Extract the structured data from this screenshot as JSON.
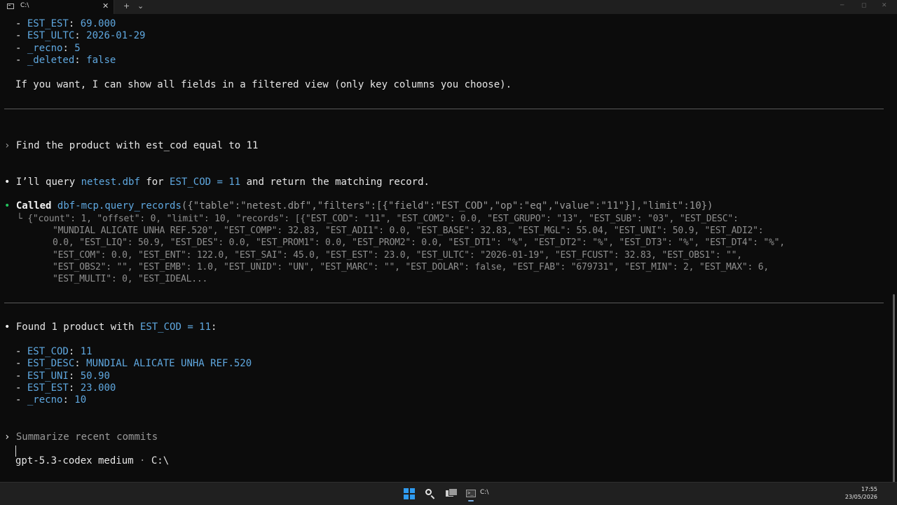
{
  "window": {
    "tab_title": "C:\\",
    "tab_close": "✕",
    "new_tab": "+",
    "dropdown": "⌄",
    "minimize": "─",
    "maximize": "◻",
    "close": "✕"
  },
  "terminal": {
    "prev_list": [
      {
        "bullet": "- ",
        "key": "EST_EST",
        "value": "69.000"
      },
      {
        "bullet": "- ",
        "key": "EST_ULTC",
        "value": "2026-01-29"
      },
      {
        "bullet": "- ",
        "key": "_recno",
        "value": "5"
      },
      {
        "bullet": "- ",
        "key": "_deleted",
        "value": "false"
      }
    ],
    "offer_text": "If you want, I can show all fields in a filtered view (only key columns you choose).",
    "user_prompt": {
      "chevron": "›",
      "text": "Find the product with est_cod equal to 11"
    },
    "assistant_intro": {
      "bullet": "•",
      "p1": "I’ll query ",
      "file": "netest.dbf",
      "p2": " for ",
      "field": "EST_COD = 11",
      "p3": " and return the matching record."
    },
    "tool_call": {
      "bullet": "•",
      "called": "Called",
      "tool": "dbf-mcp.query_records",
      "args": "({\"table\":\"netest.dbf\",\"filters\":[{\"field\":\"EST_COD\",\"op\":\"eq\",\"value\":\"11\"}],\"limit\":10})"
    },
    "tool_output": [
      "└ {\"count\": 1, \"offset\": 0, \"limit\": 10, \"records\": [{\"EST_COD\": \"11\", \"EST_COM2\": 0.0, \"EST_GRUPO\": \"13\", \"EST_SUB\": \"03\", \"EST_DESC\":",
      "\"MUNDIAL ALICATE UNHA REF.520\", \"EST_COMP\": 32.83, \"EST_ADI1\": 0.0, \"EST_BASE\": 32.83, \"EST_MGL\": 55.04, \"EST_UNI\": 50.9, \"EST_ADI2\":",
      "0.0, \"EST_LIQ\": 50.9, \"EST_DES\": 0.0, \"EST_PROM1\": 0.0, \"EST_PROM2\": 0.0, \"EST_DT1\": \"%\", \"EST_DT2\": \"%\", \"EST_DT3\": \"%\", \"EST_DT4\": \"%\",",
      "\"EST_COM\": 0.0, \"EST_ENT\": 122.0, \"EST_SAI\": 45.0, \"EST_EST\": 23.0, \"EST_ULTC\": \"2026-01-19\", \"EST_FCUST\": 32.83, \"EST_OBS1\": \"\",",
      "\"EST_OBS2\": \"\", \"EST_EMB\": 1.0, \"EST_UNID\": \"UN\", \"EST_MARC\": \"\", \"EST_DOLAR\": false, \"EST_FAB\": \"679731\", \"EST_MIN\": 2, \"EST_MAX\": 6,",
      "\"EST_MULTI\": 0, \"EST_IDEAL..."
    ],
    "found": {
      "bullet": "•",
      "p1": "Found 1 product with ",
      "field": "EST_COD = 11",
      "p2": ":"
    },
    "result_list": [
      {
        "bullet": "- ",
        "key": "EST_COD",
        "value": "11"
      },
      {
        "bullet": "- ",
        "key": "EST_DESC",
        "value": "MUNDIAL ALICATE UNHA REF.520"
      },
      {
        "bullet": "- ",
        "key": "EST_UNI",
        "value": "50.90"
      },
      {
        "bullet": "- ",
        "key": "EST_EST",
        "value": "23.000"
      },
      {
        "bullet": "- ",
        "key": "_recno",
        "value": "10"
      }
    ],
    "input": {
      "chevron": "›",
      "placeholder": "Summarize recent commits"
    },
    "status": {
      "model": "gpt-5.3-codex medium",
      "sep": " · ",
      "cwd": "C:\\"
    }
  },
  "taskbar": {
    "term_label": "C:\\",
    "time": "17:55",
    "date": "23/05/2026"
  },
  "colors": {
    "accent_blue": "#5fa8e0",
    "success_green": "#23c55e",
    "background": "#0c0c0c"
  }
}
